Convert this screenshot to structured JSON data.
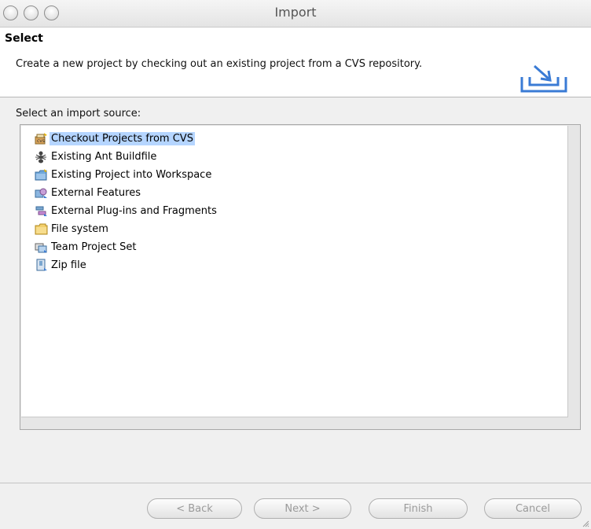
{
  "window": {
    "title": "Import"
  },
  "banner": {
    "title": "Select",
    "description": "Create a new project by checking out an existing project from a CVS repository."
  },
  "source": {
    "label": "Select an import source:",
    "items": [
      {
        "label": "Checkout Projects from CVS",
        "icon": "cvs-checkout-icon",
        "selected": true
      },
      {
        "label": "Existing Ant Buildfile",
        "icon": "ant-icon",
        "selected": false
      },
      {
        "label": "Existing Project into Workspace",
        "icon": "project-folder-icon",
        "selected": false
      },
      {
        "label": "External Features",
        "icon": "external-features-icon",
        "selected": false
      },
      {
        "label": "External Plug-ins and Fragments",
        "icon": "plugins-icon",
        "selected": false
      },
      {
        "label": "File system",
        "icon": "folder-icon",
        "selected": false
      },
      {
        "label": "Team Project Set",
        "icon": "team-project-icon",
        "selected": false
      },
      {
        "label": "Zip file",
        "icon": "zip-file-icon",
        "selected": false
      }
    ]
  },
  "buttons": {
    "back": "< Back",
    "next": "Next >",
    "finish": "Finish",
    "cancel": "Cancel"
  },
  "colors": {
    "selection": "#b5d5ff",
    "disabled_text": "#9a9a9a"
  }
}
